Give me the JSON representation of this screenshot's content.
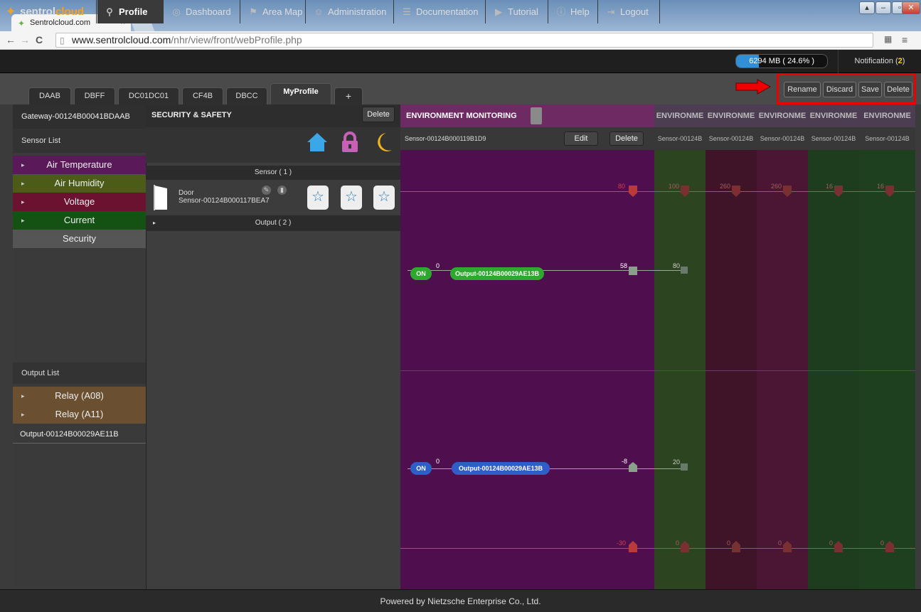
{
  "browser": {
    "tab_title": "Sentrolcloud.com",
    "tab_close": "×",
    "url_host": "www.sentrolcloud.com",
    "url_path": "/nhr/view/front/webProfile.php"
  },
  "nav": {
    "logo_a": "sentrol",
    "logo_b": "cloud",
    "items": [
      "Profile",
      "Dashboard",
      "Area Map",
      "Administration",
      "Documentation",
      "Tutorial",
      "Help",
      "Logout"
    ],
    "memory": "6294 MB ( 24.6% )",
    "memory_fraction": 0.246,
    "notification_label": "Notification (",
    "notification_count": "2",
    "notification_end": ")"
  },
  "profile_tabs": [
    "DAAB",
    "DBFF",
    "DC01DC01",
    "CF4B",
    "DBCC",
    "MyProfile",
    "+"
  ],
  "toolbar": {
    "rename": "Rename",
    "discard": "Discard",
    "save": "Save",
    "delete": "Delete"
  },
  "sidebar": {
    "gateway": "Gateway-00124B00041BDAAB",
    "sensor_list": "Sensor List",
    "sensors": [
      "Air Temperature",
      "Air Humidity",
      "Voltage",
      "Current",
      "Security"
    ],
    "output_list": "Output List",
    "outputs": [
      "Relay (A08)",
      "Relay (A11)"
    ],
    "output_device": "Output-00124B00029AE11B"
  },
  "middle": {
    "title": "SECURITY & SAFETY",
    "delete": "Delete",
    "sensor_bar": "Sensor ( 1 )",
    "sensor_name": "Door",
    "sensor_id": "Sensor-00124B000117BEA7",
    "output_bar": "Output ( 2 )"
  },
  "env": {
    "title": "ENVIRONMENT MONITORING",
    "sensor_id": "Sensor-00124B000119B1D9",
    "edit": "Edit",
    "delete": "Delete",
    "col_title": "ENVIRONME",
    "col_sensor": "Sensor-00124B",
    "top_thr": [
      "80",
      "100",
      "260",
      "260",
      "16",
      "16"
    ],
    "mid1_thr": [
      "58",
      "80"
    ],
    "mid2_thr": [
      "-8",
      "20"
    ],
    "bot_thr": [
      "-30",
      "0",
      "0",
      "0",
      "0",
      "0"
    ],
    "on": "ON",
    "zero": "0",
    "output1": "Output-00124B00029AE13B",
    "output2": "Output-00124B00029AE13B"
  },
  "colors": {
    "purple": "#4f0f4f",
    "olive": "#2d4420",
    "maroon": "#3f1428",
    "green": "#1e3c1e",
    "accent": "#f6a21b"
  },
  "footer": "Powered by Nietzsche Enterprise Co., Ltd."
}
